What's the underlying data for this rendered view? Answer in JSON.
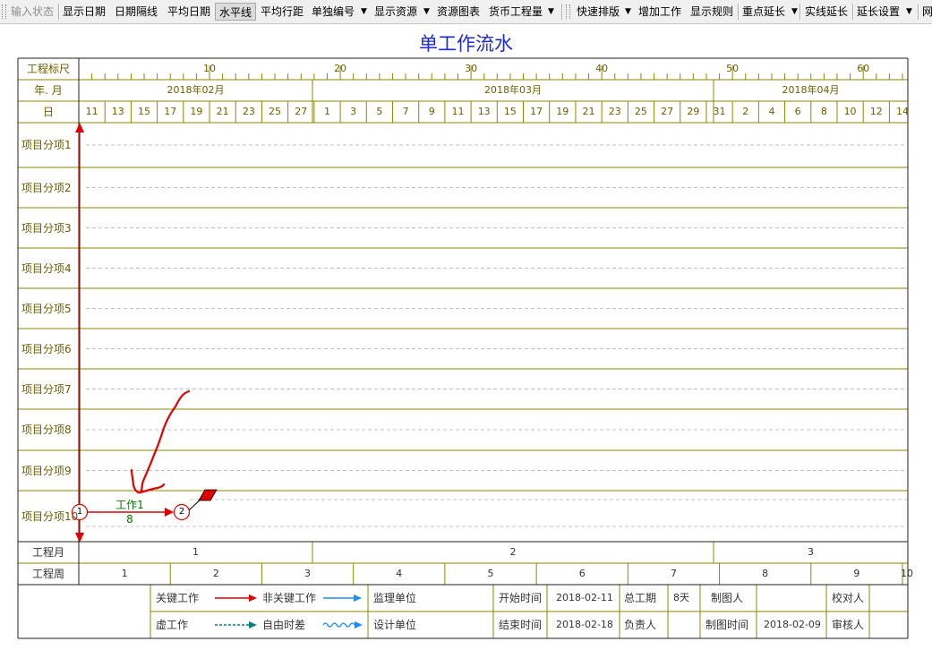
{
  "toolbar": {
    "items": [
      "输入状态",
      "显示日期",
      "日期隔线",
      "平均日期",
      "水平线",
      "平均行距",
      "单独编号",
      "显示资源",
      "资源图表",
      "货币工程量",
      "快速排版",
      "增加工作",
      "显示规则",
      "重点延长",
      "实线延长",
      "延长设置",
      "网"
    ]
  },
  "title": "单工作流水",
  "header": {
    "scale_label": "工程标尺",
    "scale_ticks": [
      "10",
      "20",
      "30",
      "40",
      "50",
      "60"
    ],
    "month_label": "年. 月",
    "months": [
      "2018年02月",
      "2018年03月",
      "2018年04月"
    ],
    "day_label": "日",
    "days": [
      "11",
      "13",
      "15",
      "17",
      "19",
      "21",
      "23",
      "25",
      "27",
      "1",
      "3",
      "5",
      "7",
      "9",
      "11",
      "13",
      "15",
      "17",
      "19",
      "21",
      "23",
      "25",
      "27",
      "29",
      "31",
      "2",
      "4",
      "6",
      "8",
      "10",
      "12",
      "14"
    ]
  },
  "rows": [
    "项目分项1",
    "项目分项2",
    "项目分项3",
    "项目分项4",
    "项目分项5",
    "项目分项6",
    "项目分项7",
    "项目分项8",
    "项目分项9",
    "项目分项10"
  ],
  "task": {
    "name": "工作1",
    "duration": "8",
    "start_node": "1",
    "end_node": "2"
  },
  "footer": {
    "project_month_label": "工程月",
    "project_months": [
      "1",
      "2",
      "3"
    ],
    "project_week_label": "工程周",
    "project_weeks": [
      "1",
      "2",
      "3",
      "4",
      "5",
      "6",
      "7",
      "8",
      "9",
      "10"
    ]
  },
  "legend": {
    "critical": "关键工作",
    "noncritical": "非关键工作",
    "dummy": "虚工作",
    "free_float": "自由时差",
    "supervisor": "监理单位",
    "designer": "设计单位",
    "start_label": "开始时间",
    "start_value": "2018-02-11",
    "end_label": "结束时间",
    "end_value": "2018-02-18",
    "total_label": "总工期",
    "total_value": "8天",
    "owner_label": "负责人",
    "drafter_label": "制图人",
    "draft_time_label": "制图时间",
    "draft_time_value": "2018-02-09",
    "checker_label": "校对人",
    "reviewer_label": "审核人"
  },
  "colors": {
    "grid_olive": "#8a8a00",
    "critical_red": "#e00000",
    "noncritical_blue": "#1e8cff",
    "title_blue": "#1e2ad8",
    "label_olive": "#6b5e00",
    "task_green": "#007a00"
  }
}
